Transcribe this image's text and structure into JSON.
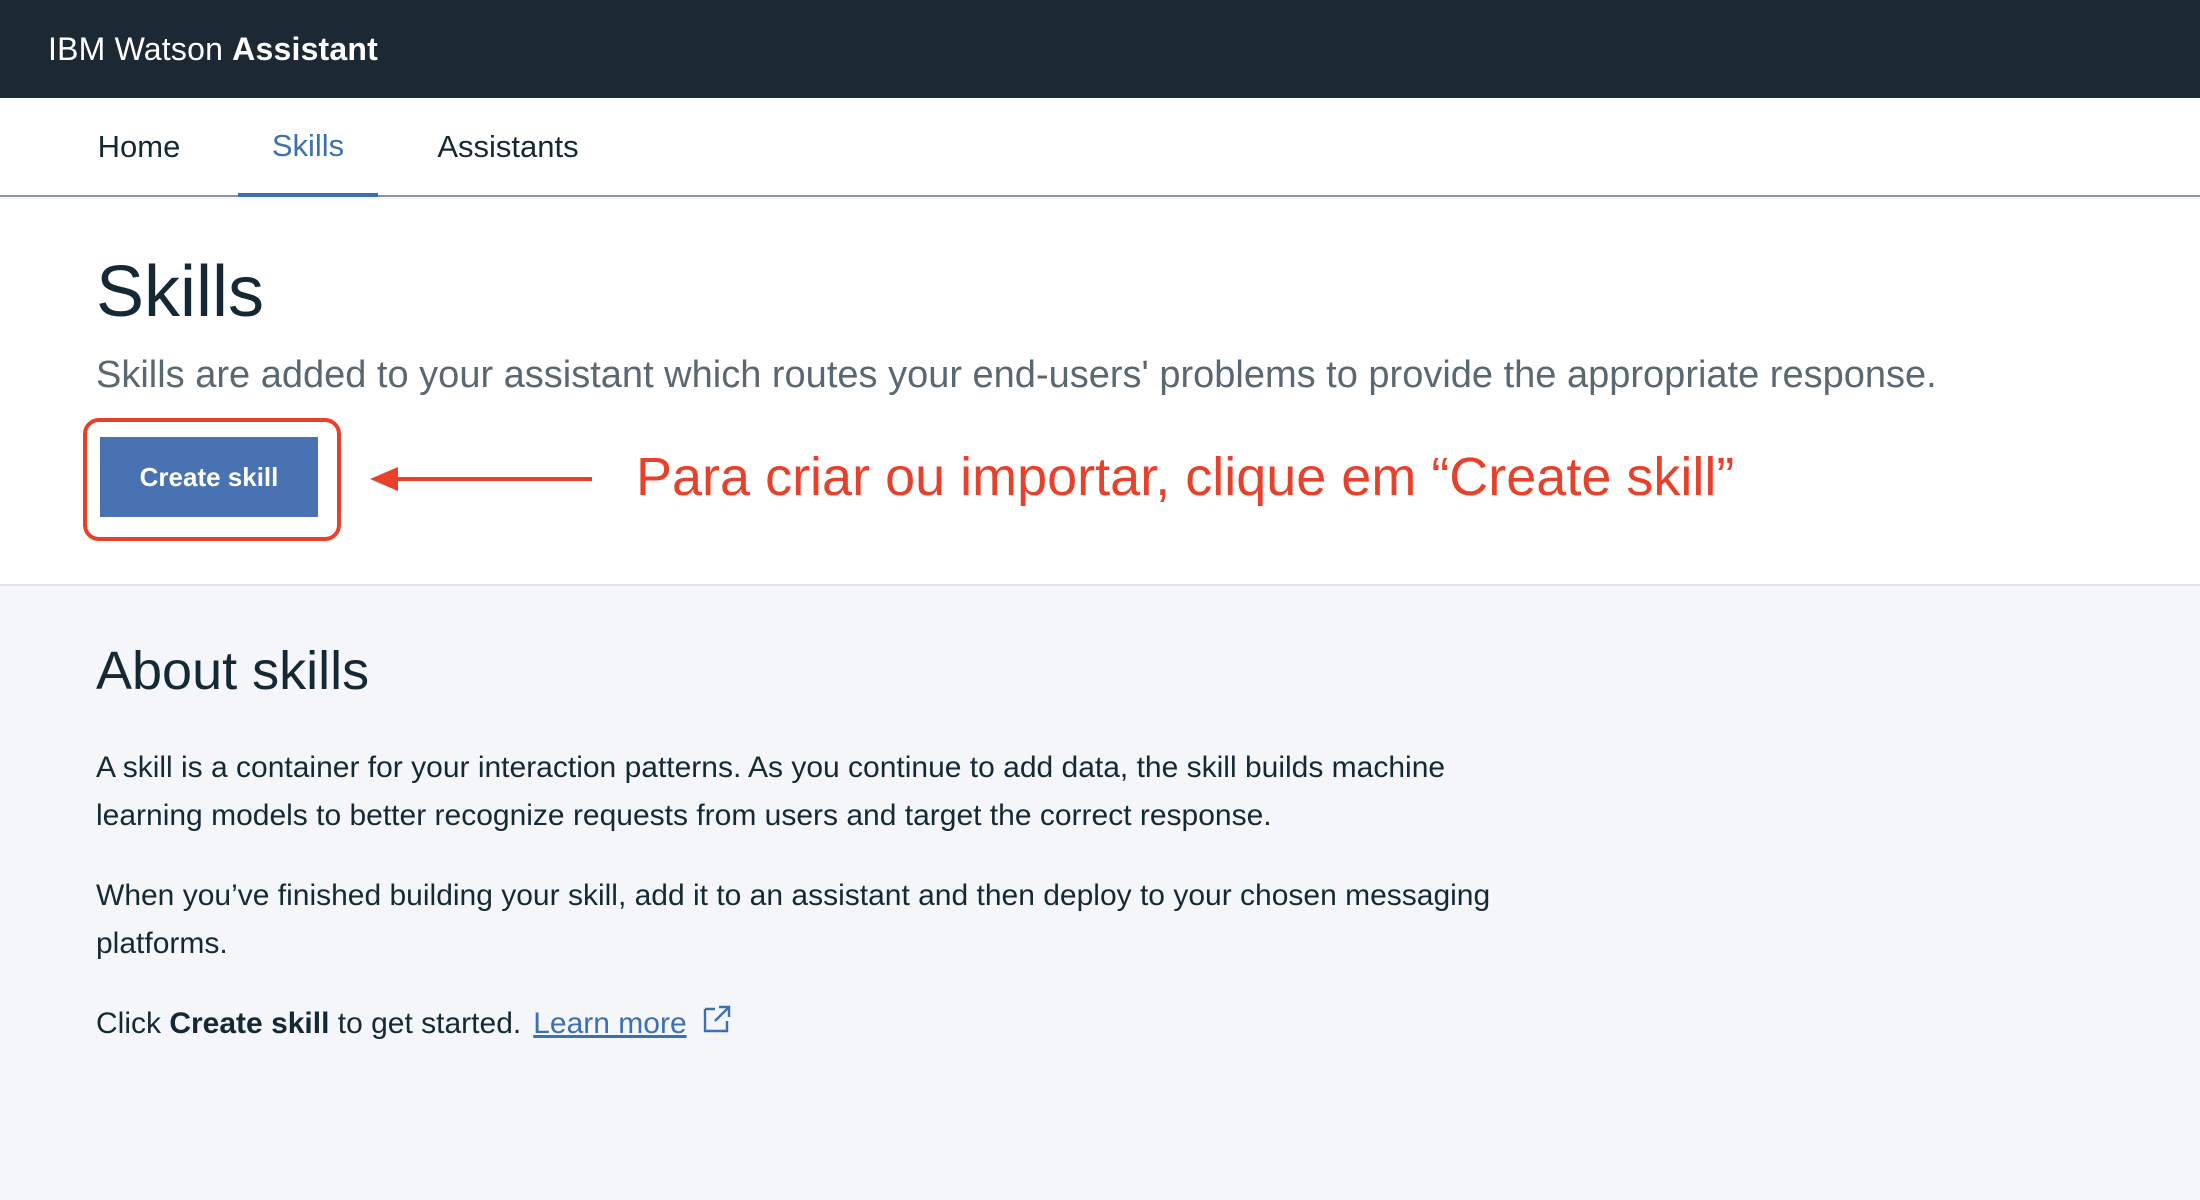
{
  "header": {
    "brand_prefix": "IBM Watson",
    "brand_bold": "Assistant"
  },
  "nav": {
    "tabs": [
      {
        "label": "Home",
        "active": false
      },
      {
        "label": "Skills",
        "active": true
      },
      {
        "label": "Assistants",
        "active": false
      }
    ]
  },
  "hero": {
    "title": "Skills",
    "description": "Skills are added to your assistant which routes your end-users' problems to provide the appropriate response.",
    "create_button": "Create skill",
    "annotation": "Para criar ou importar, clique em “Create skill”"
  },
  "about": {
    "title": "About skills",
    "paragraph1": "A skill is a container for your interaction patterns. As you continue to add data, the skill builds machine learning models to better recognize requests from users and target the correct response.",
    "paragraph2": "When you’ve finished building your skill, add it to an assistant and then deploy to your chosen messaging platforms.",
    "cta_prefix": "Click ",
    "cta_bold": "Create skill",
    "cta_suffix": " to get started.",
    "learn_more": "Learn more"
  },
  "colors": {
    "header_bg": "#1c2834",
    "accent": "#3d70b2",
    "button": "#4872b1",
    "annotation": "#e8412b"
  },
  "icons": [
    "external-link-icon",
    "arrow-left-icon"
  ]
}
